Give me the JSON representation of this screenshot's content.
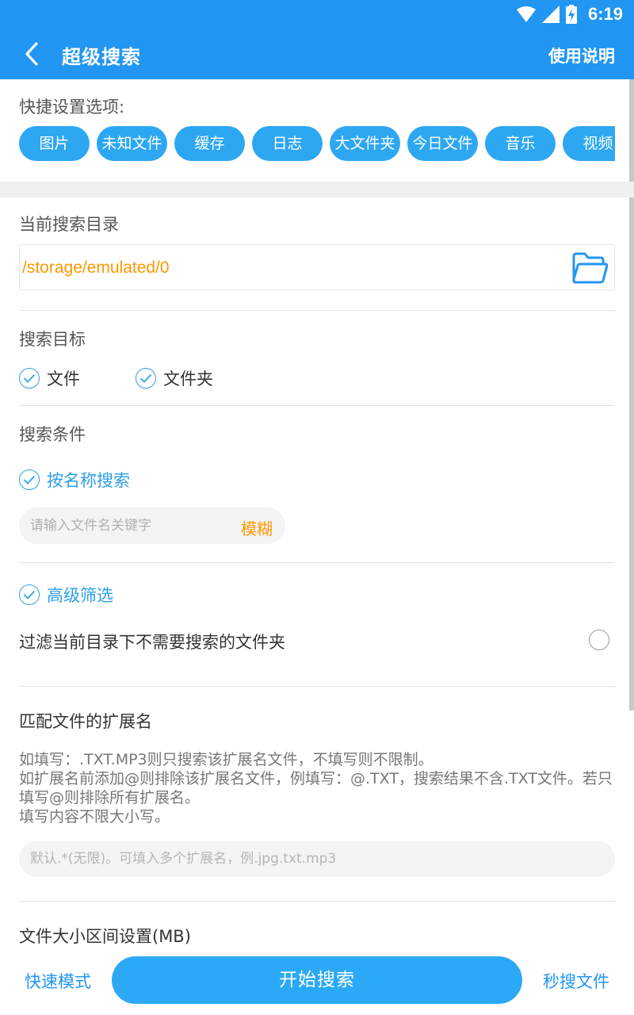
{
  "status_bar": {
    "time": "6:19"
  },
  "app_bar": {
    "title": "超级搜索",
    "help_label": "使用说明"
  },
  "quick_settings": {
    "label": "快捷设置选项:",
    "chips": [
      "图片",
      "未知文件",
      "缓存",
      "日志",
      "大文件夹",
      "今日文件",
      "音乐",
      "视频"
    ]
  },
  "directory": {
    "label": "当前搜索目录",
    "path": "/storage/emulated/0"
  },
  "search_target": {
    "label": "搜索目标",
    "options": [
      {
        "label": "文件",
        "checked": true
      },
      {
        "label": "文件夹",
        "checked": true
      }
    ]
  },
  "search_conditions": {
    "label": "搜索条件",
    "by_name": {
      "label": "按名称搜索",
      "checked": true
    },
    "keyword_placeholder": "请输入文件名关键字",
    "fuzzy_label": "模糊"
  },
  "advanced": {
    "label": "高级筛选",
    "checked": true,
    "filter_folders_label": "过滤当前目录下不需要搜索的文件夹",
    "filter_folders_checked": false
  },
  "extensions": {
    "label": "匹配文件的扩展名",
    "description_lines": [
      "如填写：.TXT.MP3则只搜索该扩展名文件，不填写则不限制。",
      "如扩展名前添加@则排除该扩展名文件，例填写：@.TXT，搜索结果不含.TXT文件。若只填写@则排除所有扩展名。",
      "填写内容不限大小写。"
    ],
    "placeholder": "默认.*(无限)。可填入多个扩展名，例.jpg.txt.mp3"
  },
  "size_range": {
    "label": "文件大小区间设置(MB)"
  },
  "bottom_bar": {
    "quick_mode": "快速模式",
    "start_search": "开始搜索",
    "instant_search": "秒搜文件"
  },
  "colors": {
    "primary": "#2196f3",
    "chip": "#2ea7f2",
    "accent_orange": "#ff9800"
  }
}
